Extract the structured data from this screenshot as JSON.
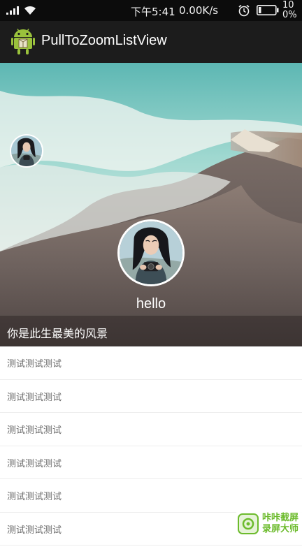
{
  "status_bar": {
    "time": "下午5:41",
    "network_speed": "0.00K/s",
    "battery_percent": "10\n0%",
    "icons": [
      "signal-icon",
      "wifi-icon",
      "alarm-icon",
      "battery-icon"
    ]
  },
  "action_bar": {
    "app_icon": "android-icon",
    "title": "PullToZoomListView"
  },
  "header": {
    "profile_name": "hello",
    "caption": "你是此生最美的风景",
    "background": "beach-scene"
  },
  "list": {
    "items": [
      "测试测试测试",
      "测试测试测试",
      "测试测试测试",
      "测试测试测试",
      "测试测试测试",
      "测试测试测试"
    ]
  },
  "watermark": {
    "line1": "咔咔截屏",
    "line2": "录屏大师"
  },
  "colors": {
    "status_bar": "#0c0c0c",
    "action_bar": "#1c1c1c",
    "list_text": "#6a6a6a",
    "watermark_green": "#6cbb2c"
  }
}
